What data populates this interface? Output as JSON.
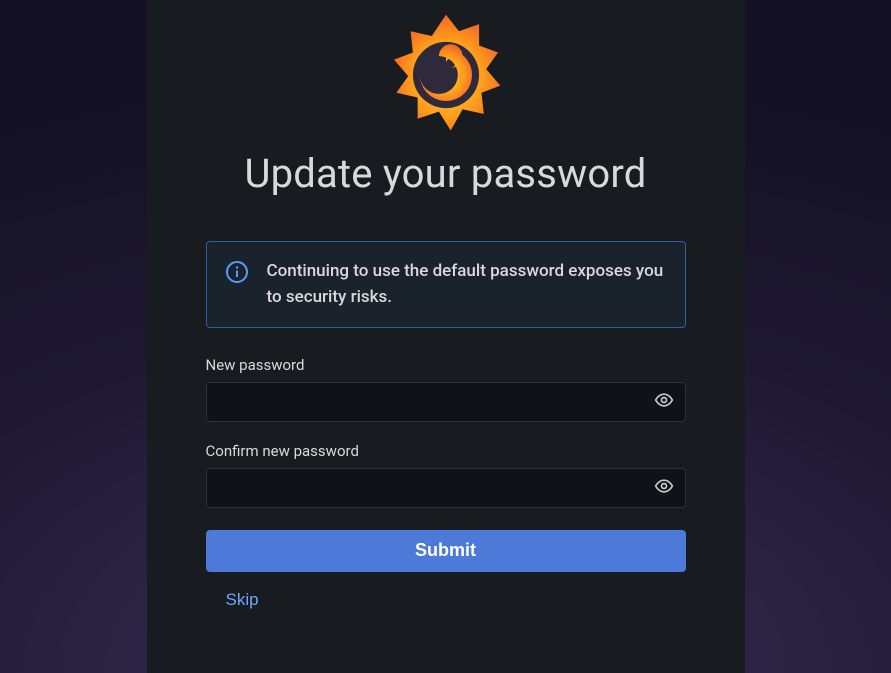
{
  "header": {
    "title": "Update your password"
  },
  "info": {
    "message": "Continuing to use the default password exposes you to security risks."
  },
  "form": {
    "new_password": {
      "label": "New password",
      "value": ""
    },
    "confirm_password": {
      "label": "Confirm new password",
      "value": ""
    },
    "submit_label": "Submit",
    "skip_label": "Skip"
  },
  "colors": {
    "panel_bg": "#181b1f",
    "accent": "#4d79d8",
    "info_border": "#2f5ea9",
    "text": "#d8d9da"
  }
}
